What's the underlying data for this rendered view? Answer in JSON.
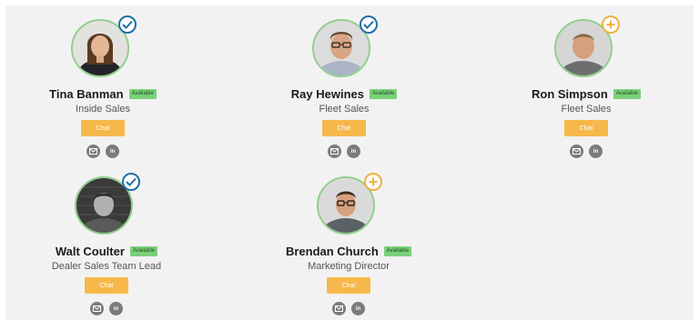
{
  "colors": {
    "panel_bg": "#f2f2f2",
    "avatar_ring": "#8fd08a",
    "status_bg": "#7ad07a",
    "chat_bg": "#f6b84a",
    "check_badge": "#1f6fa6",
    "plus_badge": "#f0b040",
    "social_icon_bg": "#7b7b7b"
  },
  "chat_label": "Chat",
  "status_label": "Available",
  "icons": {
    "email": "email-icon",
    "linkedin": "linkedin-icon",
    "linkedin_glyph": "in",
    "check": "check-icon",
    "plus": "plus-icon"
  },
  "people": [
    {
      "name": "Tina Banman",
      "title": "Inside Sales",
      "status": "Available",
      "badge": "check"
    },
    {
      "name": "Ray Hewines",
      "title": "Fleet Sales",
      "status": "Available",
      "badge": "check"
    },
    {
      "name": "Ron Simpson",
      "title": "Fleet Sales",
      "status": "Available",
      "badge": "plus"
    },
    {
      "name": "Walt Coulter",
      "title": "Dealer Sales Team Lead",
      "status": "Available",
      "badge": "check"
    },
    {
      "name": "Brendan Church",
      "title": "Marketing Director",
      "status": "Available",
      "badge": "plus"
    }
  ]
}
